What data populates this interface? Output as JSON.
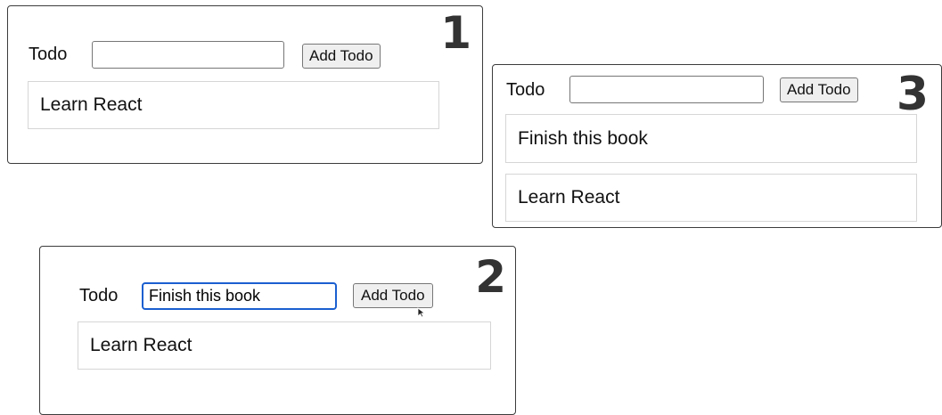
{
  "panels": [
    {
      "step": "1",
      "form": {
        "label": "Todo",
        "input_value": "",
        "button_label": "Add Todo"
      },
      "todos": [
        "Learn React"
      ]
    },
    {
      "step": "2",
      "form": {
        "label": "Todo",
        "input_value": "Finish this book",
        "button_label": "Add Todo"
      },
      "todos": [
        "Learn React"
      ]
    },
    {
      "step": "3",
      "form": {
        "label": "Todo",
        "input_value": "",
        "button_label": "Add Todo"
      },
      "todos": [
        "Finish this book",
        "Learn React"
      ]
    }
  ],
  "colors": {
    "panel_border": "#3c3c3c",
    "item_border": "#d6d6d6",
    "focus_ring": "#1a5fd0",
    "button_bg": "#efefef",
    "step_number": "#333333"
  },
  "icons": {
    "pointer": "mouse-pointer-icon"
  }
}
